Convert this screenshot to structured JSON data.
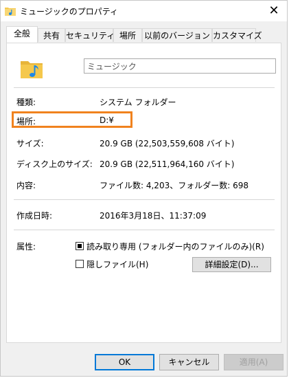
{
  "window": {
    "title": "ミュージックのプロパティ",
    "close_glyph": "✕"
  },
  "tabs": [
    {
      "label": "全般",
      "active": true
    },
    {
      "label": "共有"
    },
    {
      "label": "セキュリティ"
    },
    {
      "label": "場所"
    },
    {
      "label": "以前のバージョン"
    },
    {
      "label": "カスタマイズ"
    }
  ],
  "general": {
    "folder_name": "ミュージック",
    "type_label": "種類:",
    "type_value": "システム フォルダー",
    "location_label": "場所:",
    "location_value": "D:¥",
    "size_label": "サイズ:",
    "size_value": "20.9 GB (22,503,559,608 バイト)",
    "disk_size_label": "ディスク上のサイズ:",
    "disk_size_value": "20.9 GB (22,511,964,160 バイト)",
    "contents_label": "内容:",
    "contents_value": "ファイル数: 4,203、フォルダー数: 698",
    "created_label": "作成日時:",
    "created_value": "2016年3月18日、11:37:09",
    "attributes_label": "属性:",
    "readonly_label": "読み取り専用 (フォルダー内のファイルのみ)(R)",
    "readonly_state": "indeterminate",
    "hidden_label": "隠しファイル(H)",
    "hidden_checked": false,
    "advanced_button": "詳細設定(D)..."
  },
  "footer": {
    "ok": "OK",
    "cancel": "キャンセル",
    "apply": "適用(A)"
  },
  "colors": {
    "highlight": "#f0821e",
    "folder": "#f5c84c",
    "music_note": "#1e88e5"
  },
  "icons": {
    "title": "music-folder-icon",
    "large": "music-folder-icon"
  }
}
